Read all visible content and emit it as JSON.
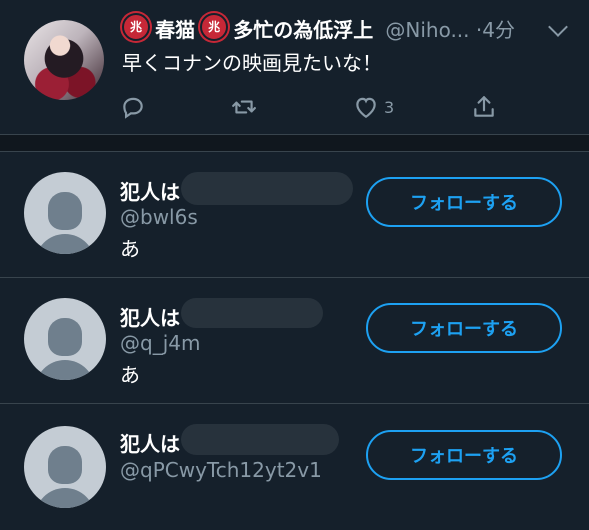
{
  "tweet": {
    "avatar_icon": "profile-photo",
    "badge_1": "兆",
    "name_part_1": "春猫",
    "badge_2": "兆",
    "name_part_2": "多忙の為低浮上",
    "handle_time": "@Niho... ·4分",
    "text": "早くコナンの映画見たいな！",
    "actions": {
      "reply_icon": "reply-icon",
      "retweet_icon": "retweet-icon",
      "like_icon": "heart-icon",
      "like_count": "3",
      "share_icon": "share-icon"
    }
  },
  "suggested_users": [
    {
      "name": "犯人は",
      "handle": "@bwl6s",
      "bio": "あ",
      "follow_label": "フォローする"
    },
    {
      "name": "犯人は",
      "handle": "@q_j4m",
      "bio": "あ",
      "follow_label": "フォローする"
    },
    {
      "name": "犯人は",
      "handle": "@qPCwyTch12yt2v1",
      "bio": "",
      "follow_label": "フォローする"
    }
  ],
  "colors": {
    "background": "#15202b",
    "accent": "#1da1f2",
    "secondary_text": "#8899a6",
    "badge": "#c62837"
  }
}
